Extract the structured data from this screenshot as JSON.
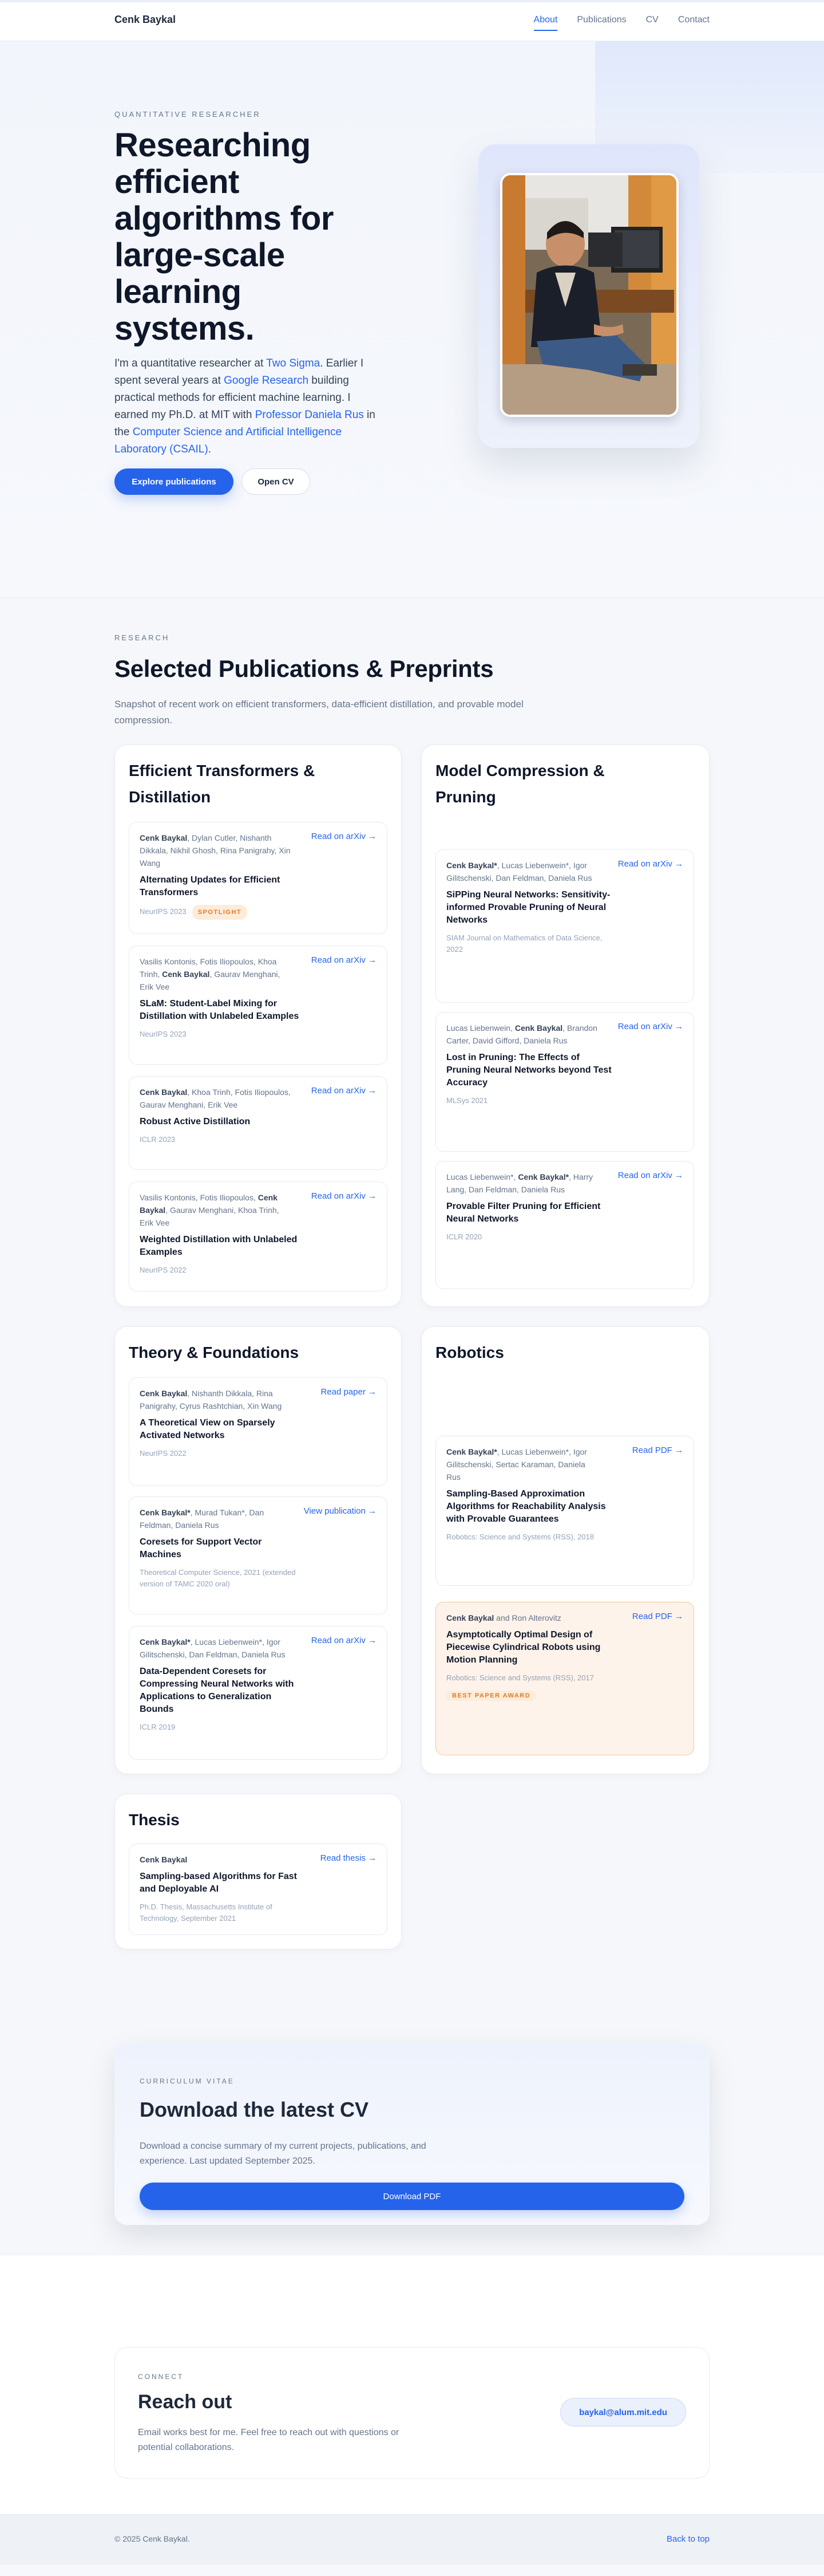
{
  "nav": {
    "brand": "Cenk Baykal",
    "links": [
      "About",
      "Publications",
      "CV",
      "Contact"
    ]
  },
  "hero": {
    "eyebrow": "QUANTITATIVE RESEARCHER",
    "headline": "Researching efficient algorithms for large-scale learning systems.",
    "intro": {
      "p1": "I'm a quantitative researcher at ",
      "l1": "Two Sigma",
      "p2": ". Earlier I spent several years at ",
      "l2": "Google Research",
      "p3": " building practical methods for efficient machine learning. I earned my Ph.D. at MIT with ",
      "l3": "Professor Daniela Rus",
      "p4": " in the ",
      "l4": "Computer Science and Artificial Intelligence Laboratory (CSAIL)",
      "p5": "."
    },
    "primary_button": "Explore publications",
    "secondary_button": "Open CV"
  },
  "research": {
    "eyebrow": "RESEARCH",
    "title": "Selected Publications & Preprints",
    "subtitle": "Snapshot of recent work on efficient transformers, data-efficient distillation, and provable model compression.",
    "groups": {
      "efficient": {
        "title": "Efficient Transformers & Distillation",
        "pubs": [
          {
            "author": "Cenk Baykal",
            "authors_rest": ", Dylan Cutler, Nishanth Dikkala, Nikhil Ghosh, Rina Panigrahy, Xin Wang",
            "title": "Alternating Updates for Efficient Transformers",
            "venue": "NeurIPS 2023",
            "badge": "SPOTLIGHT",
            "link": "Read on arXiv →"
          },
          {
            "authors_pre": "Vasilis Kontonis, Fotis Iliopoulos, Khoa Trinh, ",
            "author": "Cenk Baykal",
            "authors_rest": ", Gaurav Menghani, Erik Vee",
            "title": "SLaM: Student-Label Mixing for Distillation with Unlabeled Examples",
            "venue": "NeurIPS 2023",
            "link": "Read on arXiv →"
          },
          {
            "author": "Cenk Baykal",
            "authors_rest": ", Khoa Trinh, Fotis Iliopoulos, Gaurav Menghani, Erik Vee",
            "title": "Robust Active Distillation",
            "venue": "ICLR 2023",
            "link": "Read on arXiv →"
          },
          {
            "authors_pre": "Vasilis Kontonis, Fotis Iliopoulos, ",
            "author": "Cenk Baykal",
            "authors_rest": ", Gaurav Menghani, Khoa Trinh, Erik Vee",
            "title": "Weighted Distillation with Unlabeled Examples",
            "venue": "NeurIPS 2022",
            "link": "Read on arXiv →"
          }
        ]
      },
      "compression": {
        "title": "Model Compression & Pruning",
        "pubs": [
          {
            "author": "Cenk Baykal*",
            "authors_rest": ", Lucas Liebenwein*, Igor Gilitschenski, Dan Feldman, Daniela Rus",
            "title": "SiPPing Neural Networks: Sensitivity-informed Provable Pruning of Neural Networks",
            "venue": "SIAM Journal on Mathematics of Data Science, 2022",
            "link": "Read on arXiv →"
          },
          {
            "authors_pre": "Lucas Liebenwein, ",
            "author": "Cenk Baykal",
            "authors_rest": ", Brandon Carter, David Gifford, Daniela Rus",
            "title": "Lost in Pruning: The Effects of Pruning Neural Networks beyond Test Accuracy",
            "venue": "MLSys 2021",
            "link": "Read on arXiv →"
          },
          {
            "authors_pre": "Lucas Liebenwein*, ",
            "author": "Cenk Baykal*",
            "authors_rest": ", Harry Lang, Dan Feldman, Daniela Rus",
            "title": "Provable Filter Pruning for Efficient Neural Networks",
            "venue": "ICLR 2020",
            "link": "Read on arXiv →"
          }
        ]
      },
      "theory": {
        "title": "Theory & Foundations",
        "pubs": [
          {
            "author": "Cenk Baykal",
            "authors_rest": ", Nishanth Dikkala, Rina Panigrahy, Cyrus Rashtchian, Xin Wang",
            "title": "A Theoretical View on Sparsely Activated Networks",
            "venue": "NeurIPS 2022",
            "link": "Read paper →"
          },
          {
            "author": "Cenk Baykal*",
            "authors_rest": ", Murad Tukan*, Dan Feldman, Daniela Rus",
            "title": "Coresets for Support Vector Machines",
            "venue": "Theoretical Computer Science, 2021 (extended version of TAMC 2020 oral)",
            "link": "View publication →"
          },
          {
            "author": "Cenk Baykal*",
            "authors_rest": ", Lucas Liebenwein*, Igor Gilitschenski, Dan Feldman, Daniela Rus",
            "title": "Data-Dependent Coresets for Compressing Neural Networks with Applications to Generalization Bounds",
            "venue": "ICLR 2019",
            "link": "Read on arXiv →"
          }
        ]
      },
      "robotics": {
        "title": "Robotics",
        "pubs": [
          {
            "author": "Cenk Baykal*",
            "authors_rest": ", Lucas Liebenwein*, Igor Gilitschenski, Sertac Karaman, Daniela Rus",
            "title": "Sampling-Based Approximation Algorithms for Reachability Analysis with Provable Guarantees",
            "venue": "Robotics: Science and Systems (RSS), 2018",
            "link": "Read PDF →"
          },
          {
            "author": "Cenk Baykal",
            "authors_rest": " and Ron Alterovitz",
            "title": "Asymptotically Optimal Design of Piecewise Cylindrical Robots using Motion Planning",
            "venue": "Robotics: Science and Systems (RSS), 2017",
            "badge": "BEST PAPER AWARD",
            "link": "Read PDF →"
          }
        ]
      },
      "thesis": {
        "title": "Thesis",
        "pubs": [
          {
            "author": "Cenk Baykal",
            "authors_rest": "",
            "title": "Sampling-based Algorithms for Fast and Deployable AI",
            "venue": "Ph.D. Thesis, Massachusetts Institute of Technology, September 2021",
            "link": "Read thesis →"
          }
        ]
      }
    }
  },
  "cv": {
    "eyebrow": "CURRICULUM VITAE",
    "title": "Download the latest CV",
    "text": "Download a concise summary of my current projects, publications, and experience. Last updated September 2025.",
    "button": "Download PDF"
  },
  "contact": {
    "eyebrow": "CONNECT",
    "title": "Reach out",
    "text": "Email works best for me. Feel free to reach out with questions or potential collaborations.",
    "email": "baykal@alum.mit.edu"
  },
  "footer": {
    "copyright": "© 2025 Cenk Baykal.",
    "back_to_top": "Back to top"
  },
  "colors": {
    "accent": "#2563eb",
    "badge_bg": "#fdecd9",
    "badge_text": "#e07b28"
  }
}
